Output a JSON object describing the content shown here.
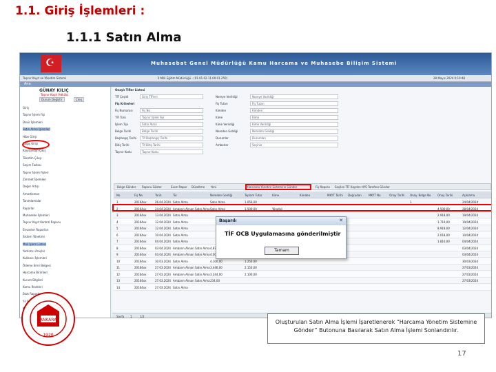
{
  "slide": {
    "title": "1.1. Giriş İşlemleri :",
    "subtitle": "1.1.1  Satın Alma",
    "caption": "Oluşturulan Satın Alma İşlemi İşaretlenerek “Harcama Yönetim Sistemine Gönder” Butonuna Basılarak Satın Alma İşlemi Sonlandırılır.",
    "page": "17",
    "logo_text": "MİLLİ EĞİTİM BAKANLIĞI",
    "logo_year": "1920",
    "logo_center": "ANKARA"
  },
  "app": {
    "banner": "Muhasebat Genel Müdürlüğü Kamu Harcama ve Muhasebe Bilişim Sistemi",
    "left_bar": "Taşınır Kayıt ve Yönetim Sistemi",
    "center_bar": "İl Milli Eğitim Müdürlüğü - (01.01.02.11.00.01.250)",
    "date": "28 Mayıs 2024 0:10:48",
    "menu_item": "Ana"
  },
  "user": {
    "name": "GÜNAY KILIÇ",
    "role": "Taşınır Kayıt Yetkilisi",
    "btn1": "Durum Değiştir",
    "btn2": "Çıkış"
  },
  "tree": [
    {
      "label": "Giriş",
      "hl": false
    },
    {
      "label": "Taşınır İşlem Fişi",
      "hl": false
    },
    {
      "label": "Devir İşlemleri",
      "hl": false
    },
    {
      "label": "Satın Alma İşlemleri",
      "hl": true
    },
    {
      "label": "Hibe Girişi",
      "hl": false
    },
    {
      "label": "Bağış Girişi",
      "hl": false
    },
    {
      "label": "Kayıtlardan Çıkış",
      "hl": false
    },
    {
      "label": "Tüketim Çıkışı",
      "hl": false
    },
    {
      "label": "Sayım Fazlası",
      "hl": false
    },
    {
      "label": "Taşınır İşlem Fişleri",
      "hl": false
    },
    {
      "label": "Zimmet İşlemleri",
      "hl": false
    },
    {
      "label": "Değer Artışı",
      "hl": false
    },
    {
      "label": "Amortisman",
      "hl": false
    },
    {
      "label": "Tanımlamalar",
      "hl": false
    },
    {
      "label": "Raporlar",
      "hl": false
    },
    {
      "label": "Muhasebe İşlemleri",
      "hl": false
    },
    {
      "label": "Taşınır Kayıt Kontrol Raporu",
      "hl": false
    },
    {
      "label": "Envanter Raporları",
      "hl": false
    },
    {
      "label": "Sistem Yönetimi",
      "hl": false
    },
    {
      "label": "Mali İşlem Listesi",
      "hl": true
    },
    {
      "label": "Yardımcı Araçlar",
      "hl": false
    },
    {
      "label": "Kullanıcı İşlemleri",
      "hl": false
    },
    {
      "label": "Ödeme Emri Belgesi",
      "hl": false
    },
    {
      "label": "Harcama Birimleri",
      "hl": false
    },
    {
      "label": "Kurum Bilgileri",
      "hl": false
    },
    {
      "label": "Kamu İhaleleri",
      "hl": false
    },
    {
      "label": "Stok Raporları",
      "hl": false
    },
    {
      "label": "Yıl Sonu İşlemleri",
      "hl": false
    },
    {
      "label": "Kullanıcı Ekranı",
      "hl": false
    }
  ],
  "form": {
    "panel_title": "Onaylı Tifler Listesi",
    "tif_type_label": "TİF Çeşidi",
    "tif_type_value": "Giriş TİFleri",
    "section": "Fiş Kriterleri",
    "left": [
      {
        "label": "Fiş Numarası",
        "value": "Fiş No"
      },
      {
        "label": "TİF Türü",
        "value": "Taşınır İşlem Fişi"
      },
      {
        "label": "İşlem Tipi",
        "value": "Satın Alma"
      },
      {
        "label": "Belge Tarihi",
        "value": "Belge Tarihi"
      },
      {
        "label": "Başlangıç Tarihi",
        "value": "Tif Başlangıç Tarihi"
      },
      {
        "label": "Bitiş Tarihi",
        "value": "Tif Bitiş Tarihi"
      },
      {
        "label": "Taşınır Kodu",
        "value": "Taşınır Kodu"
      }
    ],
    "right": [
      {
        "label": "Nereye Verildiği",
        "value": "Nereye Verildiği"
      },
      {
        "label": "Fiş Tutarı",
        "value": "Fiş Tutarı"
      },
      {
        "label": "Kimden",
        "value": "Kimden"
      },
      {
        "label": "Kime",
        "value": "Kime"
      },
      {
        "label": "Kime Verildiği",
        "value": "Kime Verildiği"
      },
      {
        "label": "Nereden Geldiği",
        "value": "Nereden Geldiği"
      },
      {
        "label": "Durumlar",
        "value": "Durumları"
      },
      {
        "label": "Ambarlar",
        "value": "Seçiniz"
      }
    ]
  },
  "toolbar": [
    "Belge Gönder",
    "Raporu Göster",
    "Excel Rapor",
    "Düzeltme",
    "Yeni",
    "Harcama Yönetim Sistemine Gönder",
    "Fiş Raporu",
    "Seçilen TİF Kaydını HYS Tarafına Gönder"
  ],
  "table": {
    "headers": [
      "No",
      "Fiş No",
      "Tarih",
      "Tür",
      "Nereden Geldiği",
      "Toplam Tutar",
      "Kime",
      "Kimden",
      "MKYT Tarihi",
      "Doğrudan",
      "MKYT No",
      "Onay Tarihi",
      "Onay. Belge No",
      "Onay Tarihi",
      "Açıklama"
    ],
    "rows": [
      [
        "1",
        "20164xx",
        "26.04.2024",
        "Satın Alma",
        "Satın Alma",
        "1.056,00",
        "",
        "",
        "",
        "",
        "",
        "",
        "1",
        "",
        "24/04/2024"
      ],
      [
        "2",
        "20164xx",
        "24.04.2024",
        "Ambarın Alınan Satın Alma",
        "Satın Alma",
        "1.500,00",
        "Yönetici",
        "",
        "",
        "",
        "",
        "",
        "",
        "4.500,00",
        "28/04/2024"
      ],
      [
        "3",
        "20164xx",
        "13.04.2024",
        "Satın Alma",
        "",
        "",
        "",
        "",
        "",
        "",
        "",
        "",
        "",
        "2.918,00",
        "19/04/2024"
      ],
      [
        "4",
        "20164xx",
        "12.04.2024",
        "Satın Alma",
        "",
        "",
        "",
        "",
        "",
        "",
        "",
        "",
        "",
        "1.719,00",
        "19/04/2024"
      ],
      [
        "5",
        "20164xx",
        "12.04.2024",
        "Satın Alma",
        "",
        "",
        "",
        "",
        "",
        "",
        "",
        "",
        "",
        "8.918,00",
        "12/04/2024"
      ],
      [
        "6",
        "20164xx",
        "10.04.2024",
        "Satın Alma",
        "",
        "",
        "",
        "",
        "",
        "",
        "",
        "",
        "",
        "2.018,00",
        "10/04/2024"
      ],
      [
        "7",
        "20164xx",
        "04.04.2024",
        "Satın Alma",
        "",
        "",
        "",
        "",
        "",
        "",
        "",
        "",
        "",
        "1.816,00",
        "04/04/2024"
      ],
      [
        "8",
        "20164xx",
        "03.04.2024",
        "Ambarın Alınan Satın Alma",
        "4.870,00",
        "",
        "",
        "",
        "",
        "",
        "",
        "",
        "",
        "",
        "03/04/2024"
      ],
      [
        "9",
        "20164xx",
        "03.04.2024",
        "Ambarın Alınan Satın Alma",
        "4.000,00",
        "1.650,00",
        "",
        "",
        "",
        "",
        "",
        "",
        "",
        "",
        "03/04/2024"
      ],
      [
        "10",
        "20164xx",
        "30.03.2024",
        "Satın Alma",
        "4.100,00",
        "1.250,00",
        "",
        "",
        "",
        "",
        "",
        "",
        "",
        "",
        "30/03/2024"
      ],
      [
        "11",
        "20164xx",
        "27.03.2024",
        "Ambarın Alınan Satın Alma",
        "3.446,00",
        "2.150,00",
        "",
        "",
        "",
        "",
        "",
        "",
        "",
        "",
        "27/03/2024"
      ],
      [
        "12",
        "20164xx",
        "27.03.2024",
        "Ambarın Alınan Satın Alma",
        "3.244,00",
        "2.100,00",
        "",
        "",
        "",
        "",
        "",
        "",
        "",
        "",
        "27/03/2024"
      ],
      [
        "13",
        "20164xx",
        "27.03.2024",
        "Ambarın Alınan Satın Alma",
        "234,00",
        "",
        "",
        "",
        "",
        "",
        "",
        "",
        "",
        "",
        "27/03/2024"
      ],
      [
        "14",
        "20164xx",
        "27.03.2024",
        "Satın Alma",
        "",
        "",
        "",
        "",
        "",
        "",
        "",
        "",
        "",
        "",
        ""
      ]
    ]
  },
  "dialog": {
    "title": "Başarılı",
    "message": "TİF OCB Uygulamasına gönderilmiştir",
    "ok": "Tamam"
  },
  "pager": {
    "label": "Sayfa",
    "page": "1",
    "of": "1/2",
    "info": "Onaylı TİF Sayısı : 1637"
  }
}
